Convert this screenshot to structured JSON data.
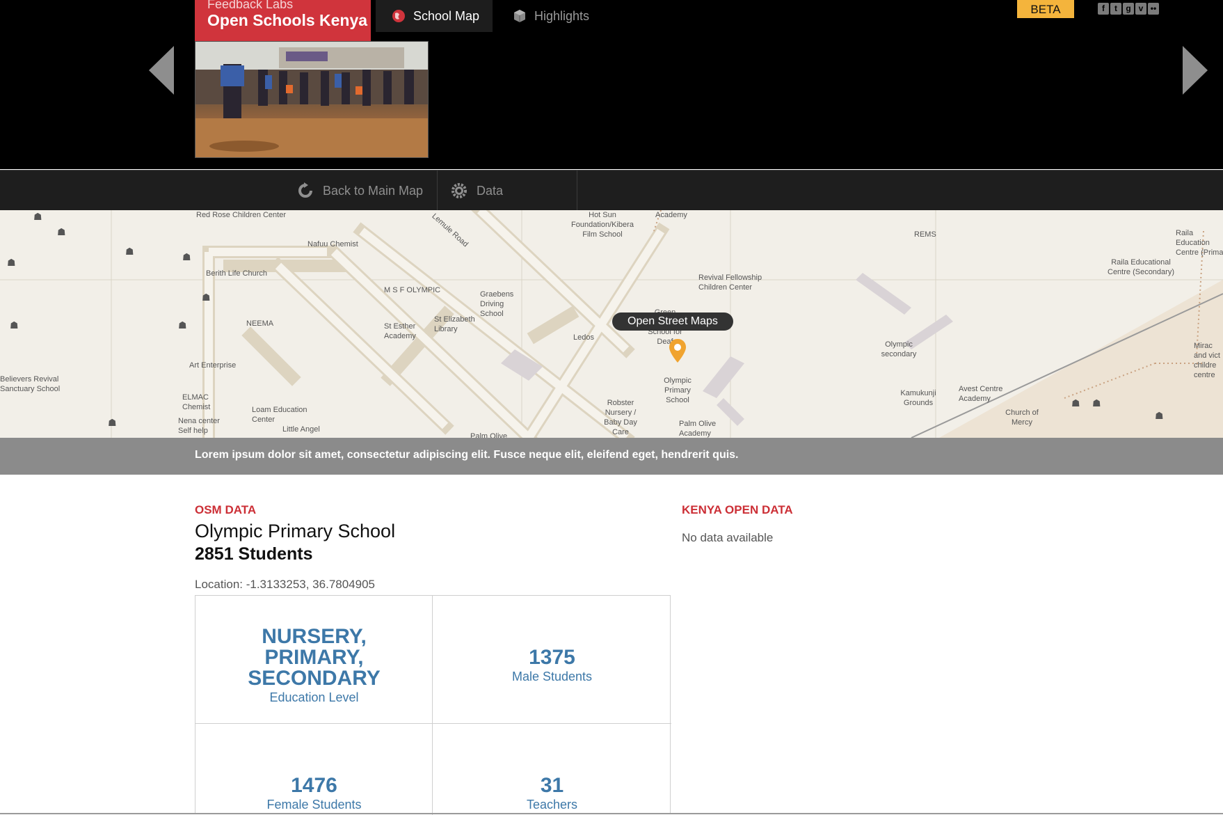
{
  "header": {
    "brand_small": "Feedback Labs",
    "brand_title": "Open Schools Kenya",
    "tabs": [
      {
        "label": "School Map",
        "active": true,
        "icon": "globe-icon"
      },
      {
        "label": "Highlights",
        "active": false,
        "icon": "cube-icon"
      }
    ],
    "beta": "BETA",
    "social_icons": [
      "facebook-icon",
      "twitter-icon",
      "google-plus-icon",
      "vimeo-icon",
      "flickr-icon"
    ]
  },
  "subnav": {
    "back_label": "Back to Main Map",
    "data_label": "Data"
  },
  "map": {
    "tooltip": "Open Street Maps",
    "labels": [
      "Red Rose Children Center",
      "Nafuu Chemist",
      "Berith Life Church",
      "NEEMA",
      "Art Enterprise",
      "Believers Revival Sanctuary School",
      "ELMAC Chemist",
      "Nena center Self help",
      "Loam Education Center",
      "Little Angel",
      "M S F  OLYMPIC",
      "St Esther Academy",
      "St Elizabeth Library",
      "Graebens Driving School",
      "Lemule Road",
      "Hot Sun Foundation/Kibera Film School",
      "Academy",
      "Ledos",
      "Revival Fellowship Children Center",
      "Green House School for Deaf",
      "Olympic Primary School",
      "Robster Nursery / Baby Day Care Center",
      "Palm Olive Academy",
      "Palm Olive",
      "REMS",
      "Olympic secondary",
      "Kamukunji Grounds",
      "Avest Centre Academy",
      "Church of Mercy",
      "Raila Educational Centre (Secondary)",
      "Raila Education Centre (Prima",
      "Mirac and vict childre centre"
    ]
  },
  "banner": {
    "text": "Lorem ipsum dolor sit amet, consectetur adipiscing elit. Fusce neque elit, eleifend eget, hendrerit quis."
  },
  "osm": {
    "title": "OSM DATA",
    "school_name": "Olympic Primary School",
    "students": "2851 Students",
    "location": "Location: -1.3133253, 36.7804905",
    "stats": [
      {
        "value": "NURSERY, PRIMARY, SECONDARY",
        "label": "Education Level"
      },
      {
        "value": "1375",
        "label": "Male Students"
      },
      {
        "value": "1476",
        "label": "Female Students"
      },
      {
        "value": "31",
        "label": "Teachers"
      }
    ]
  },
  "kenya": {
    "title": "KENYA OPEN DATA",
    "no_data": "No data available"
  },
  "colors": {
    "brand_red": "#d0343c",
    "accent_blue": "#3d78a8",
    "beta_yellow": "#f4b43c",
    "pin_orange": "#f0a32f"
  }
}
